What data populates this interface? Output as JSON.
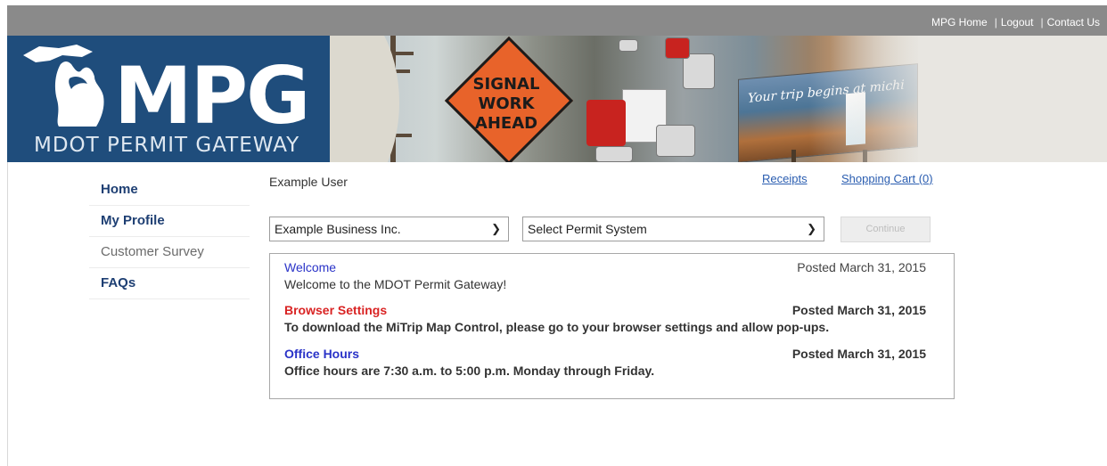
{
  "header": {
    "links": [
      {
        "label": "MPG Home"
      },
      {
        "label": "Logout"
      },
      {
        "label": "Contact Us"
      }
    ]
  },
  "banner": {
    "logo_main": "MPG",
    "logo_sub": "MDOT PERMIT GATEWAY",
    "sign_lines": [
      "SIGNAL",
      "WORK",
      "AHEAD"
    ],
    "billboard_text": "Your trip begins at michi",
    "colors": {
      "logo_blue": "#1f4d7c",
      "sign_orange": "#e8632a"
    }
  },
  "sidebar": {
    "items": [
      {
        "label": "Home",
        "style": "bold"
      },
      {
        "label": "My Profile",
        "style": "bold"
      },
      {
        "label": "Customer Survey",
        "style": "plain"
      },
      {
        "label": "FAQs",
        "style": "bold"
      }
    ]
  },
  "main": {
    "user_name": "Example User",
    "receipts_label": "Receipts",
    "cart_label": "Shopping Cart (0)",
    "business_select": {
      "value": "Example Business Inc."
    },
    "permit_select": {
      "value": "Select Permit System"
    },
    "continue_label": "Continue",
    "news": [
      {
        "title": "Welcome",
        "date": "Posted March 31, 2015",
        "body": "Welcome to the MDOT Permit Gateway!"
      },
      {
        "title": "Browser Settings",
        "date": "Posted March 31, 2015",
        "body": "To download the MiTrip Map Control, please go to your browser settings and allow pop-ups."
      },
      {
        "title": "Office Hours",
        "date": "Posted March 31, 2015",
        "body": "Office hours are 7:30 a.m. to 5:00 p.m. Monday through Friday."
      }
    ]
  }
}
